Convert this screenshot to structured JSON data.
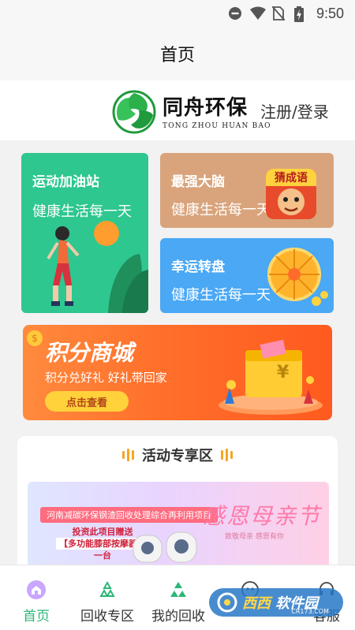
{
  "status_bar": {
    "time": "9:50",
    "icons": [
      "do-not-disturb-icon",
      "wifi-icon",
      "no-sim-icon",
      "battery-charging-icon"
    ]
  },
  "header": {
    "title": "首页"
  },
  "brand": {
    "name": "同舟环保",
    "name_en": "TONG ZHOU HUAN BAO",
    "login_label": "注册/登录"
  },
  "cards": [
    {
      "title": "运动加油站",
      "subtitle": "健康生活每一天",
      "color": "#2dc78f"
    },
    {
      "title": "最强大脑",
      "subtitle": "健康生活每一天",
      "badge": "猜成语",
      "color": "#d9a47c"
    },
    {
      "title": "幸运转盘",
      "subtitle": "健康生活每一天",
      "color": "#4aa8f5"
    }
  ],
  "mall_banner": {
    "title": "积分商城",
    "subtitle": "积分兑好礼 好礼带回家",
    "button_label": "点击查看",
    "symbol": "¥"
  },
  "activity": {
    "title": "活动专享区",
    "promo": {
      "headline": "河南减碳环保钢渣回收处理综合再利用项目",
      "offer_line1": "投资此项目赠送",
      "offer_line2": "【多功能膝部按摩器】",
      "offer_line3": "一台",
      "festival": "感恩母亲节",
      "festival_sub": "致敬母亲 感恩有你"
    }
  },
  "tabs": [
    {
      "label": "首页",
      "icon": "home-icon",
      "active": true
    },
    {
      "label": "回收专区",
      "icon": "recycle-icon",
      "active": false
    },
    {
      "label": "我的回收",
      "icon": "recycle-filled-icon",
      "active": false
    },
    {
      "label": "",
      "icon": "robot-icon",
      "active": false
    },
    {
      "label": "客服",
      "icon": "headset-icon",
      "active": false
    }
  ],
  "watermark": {
    "part1": "西西",
    "part2": "软件园",
    "url": "CR173.COM"
  },
  "colors": {
    "accent": "#2cb676",
    "orange": "#ff6f2a",
    "yellow": "#ffd13a"
  }
}
